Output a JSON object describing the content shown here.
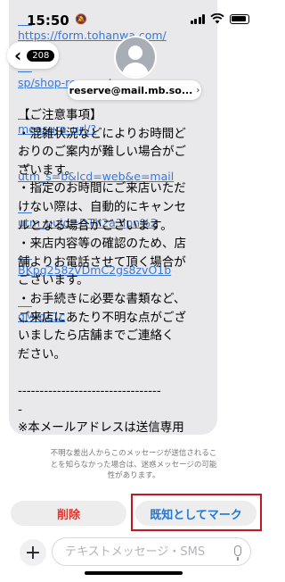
{
  "status_bar": {
    "time": "15:50",
    "bell_icon": "bell-slash-icon"
  },
  "nav": {
    "unread_count": "208",
    "contact": "reserve@mail.mb.so..."
  },
  "message": {
    "url_lines": [
      "https://form.tohanwa.com/",
      "sp/shop-reserve/",
      "measure_url/?",
      "utm_s=b&lcd=web&e=mail",
      "utm_uuid=DTh2a3lpn%2",
      "BKpg258zVDmC2gs8zvO1b",
      "qMrqc1c"
    ],
    "body": "【ご注意事項】\n・混雑状況などによりお時間ど\nおりのご案内が難しい場合がご\nざいます。\n・指定のお時間にご来店いただ\nけない際は、自動的にキャンセ\nルとなる場合がございます。\n・来店内容等の確認のため、店\n舗よりお電話させて頂く場合が\nございます。\n・お手続きに必要な書類など、\nご来店にあたり不明な点がござ\nいましたら店舗までご連絡く\nださい。\n\n---------------------------------\n-\n※本メールアドレスは送信専用\nのため、返信できません。お心\n当たりがない場合は、破棄して\nください。"
  },
  "spam_notice": "不明な差出人からこのメッセージが送信されるこ\nとを知らなかった場合は、迷惑メッセージの可能\n性があります。",
  "actions": {
    "delete": "削除",
    "mark_known": "既知としてマーク"
  },
  "compose": {
    "placeholder": "テキストメッセージ・SMS"
  },
  "colors": {
    "bubble": "#e9e9eb",
    "link": "#3a78d6",
    "delete": "#e0342c",
    "known": "#1f77d6",
    "highlight": "#c4171e"
  }
}
